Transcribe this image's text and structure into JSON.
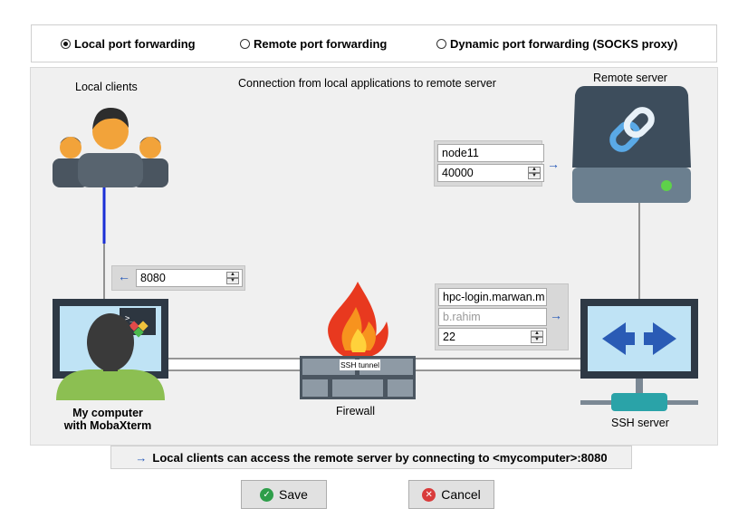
{
  "modes": {
    "local": "Local port forwarding",
    "remote": "Remote port forwarding",
    "dynamic": "Dynamic port forwarding (SOCKS proxy)",
    "selected": "local"
  },
  "diagram": {
    "local_clients_label": "Local clients",
    "connection_label": "Connection from local applications to remote server",
    "remote_server_label": "Remote server",
    "my_computer_line1": "My computer",
    "my_computer_line2": "with MobaXterm",
    "firewall_label": "Firewall",
    "ssh_tunnel_label": "SSH tunnel",
    "ssh_server_label": "SSH server"
  },
  "fields": {
    "remote_host": "node11",
    "remote_port": "40000",
    "local_port": "8080",
    "ssh_server": "hpc-login.marwan.m",
    "ssh_user_placeholder": "b.rahim",
    "ssh_port": "22"
  },
  "summary": "Local clients can access the remote server by connecting to <mycomputer>:8080",
  "buttons": {
    "save": "Save",
    "cancel": "Cancel"
  },
  "colors": {
    "accent_blue": "#2457b8",
    "save_green": "#2e9e4a",
    "cancel_red": "#d93b3b"
  },
  "icons": [
    "users-icon",
    "server-link-icon",
    "computer-user-icon",
    "firewall-icon",
    "ssh-server-icon",
    "arrow-right-icon",
    "arrow-left-icon",
    "check-icon",
    "cancel-icon"
  ]
}
